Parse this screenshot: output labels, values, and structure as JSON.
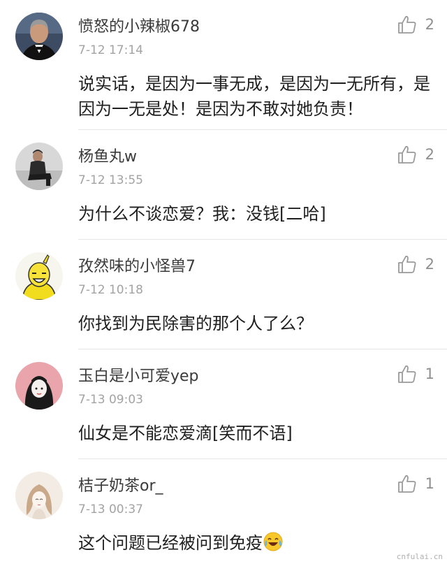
{
  "comments": [
    {
      "username": "愤怒的小辣椒678",
      "time": "7-12 17:14",
      "text": "说实话，是因为一事无成，是因为一无所有，是因为一无是处！是因为不敢对她负责！",
      "likes": "2",
      "avatar": "man-in-tuxedo-avatar"
    },
    {
      "username": "杨鱼丸w",
      "time": "7-12 13:55",
      "text": "为什么不谈恋爱？我：没钱[二哈]",
      "likes": "2",
      "avatar": "sitting-person-avatar"
    },
    {
      "username": "孜然味的小怪兽7",
      "time": "7-12 10:18",
      "text": "你找到为民除害的那个人了么？",
      "likes": "2",
      "avatar": "yellow-cartoon-avatar"
    },
    {
      "username": "玉白是小可爱yep",
      "time": "7-13 09:03",
      "text": "仙女是不能恋爱滴[笑而不语]",
      "likes": "1",
      "avatar": "pink-girl-avatar"
    },
    {
      "username": "桔子奶茶or_",
      "time": "7-13 00:37",
      "text": "这个问题已经被问到免疫",
      "likes": "1",
      "avatar": "sketch-girl-avatar",
      "emoji": "laughing-crying-emoji"
    }
  ],
  "watermark": "cnfulai.cn",
  "colors": {
    "text": "#1f1f1f",
    "username": "#3a3a3a",
    "time": "#a3a3a3",
    "like": "#8f8f8f",
    "divider": "#e6e6e6"
  }
}
